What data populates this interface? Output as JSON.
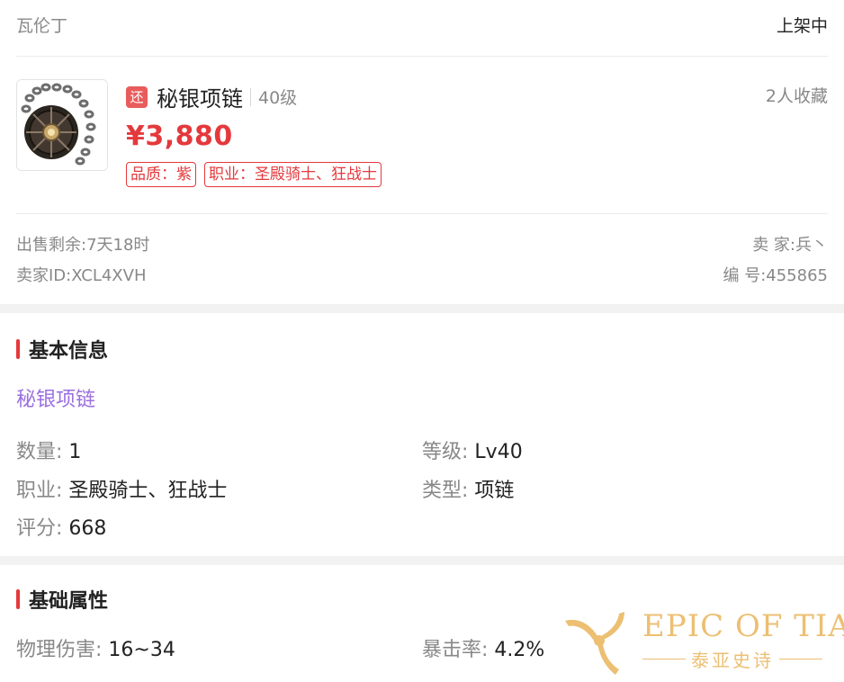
{
  "header": {
    "server": "瓦伦丁",
    "status": "上架中"
  },
  "item": {
    "badge": "还",
    "name": "秘银项链",
    "level": "40级",
    "favorites": "2人收藏",
    "price": "¥3,880",
    "tags": [
      "品质：紫",
      "职业：圣殿骑士、狂战士"
    ]
  },
  "meta": {
    "remain_label": "出售剩余:",
    "remain_value": "7天18时",
    "seller_label": "卖 家:",
    "seller_value": "兵丶",
    "sellerid_label": "卖家ID:",
    "sellerid_value": "XCL4XVH",
    "number_label": "编 号:",
    "number_value": "455865"
  },
  "basic": {
    "title": "基本信息",
    "item_name": "秘银项链",
    "item_name_color": "#9b6fe0",
    "rows": [
      {
        "label": "数量:",
        "value": "1"
      },
      {
        "label": "等级:",
        "value": "Lv40"
      },
      {
        "label": "职业:",
        "value": "圣殿骑士、狂战士"
      },
      {
        "label": "类型:",
        "value": "项链"
      },
      {
        "label": "评分:",
        "value": "668"
      }
    ]
  },
  "attributes": {
    "title": "基础属性",
    "rows": [
      {
        "label": "物理伤害:",
        "value": "16~34"
      },
      {
        "label": "暴击率:",
        "value": "4.2%"
      }
    ]
  },
  "watermark": {
    "brand": "EPIC OF TIA",
    "subtitle": "泰亚史诗"
  },
  "colors": {
    "accent": "#e4393c",
    "muted": "#888888",
    "purple": "#9b6fe0"
  }
}
